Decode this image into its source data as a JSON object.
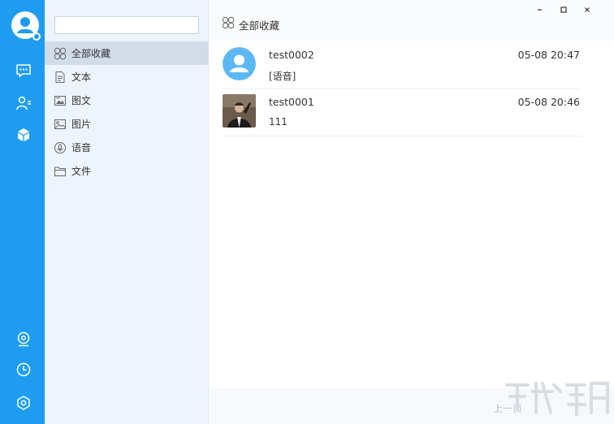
{
  "search": {
    "placeholder": "",
    "value": ""
  },
  "rail": {
    "avatar_icon": "user-avatar-icon",
    "items": [
      {
        "name": "chat",
        "icon": "chat-bubble-icon"
      },
      {
        "name": "contacts",
        "icon": "contacts-icon"
      },
      {
        "name": "favorites",
        "icon": "cube-icon",
        "active": true
      }
    ],
    "bottom_items": [
      {
        "name": "location",
        "icon": "location-icon"
      },
      {
        "name": "history",
        "icon": "clock-icon"
      },
      {
        "name": "settings",
        "icon": "gear-icon"
      }
    ]
  },
  "categories": [
    {
      "label": "全部收藏",
      "icon": "grid-icon",
      "active": true
    },
    {
      "label": "文本",
      "icon": "text-file-icon"
    },
    {
      "label": "图文",
      "icon": "image-text-icon"
    },
    {
      "label": "图片",
      "icon": "picture-icon"
    },
    {
      "label": "语音",
      "icon": "voice-icon"
    },
    {
      "label": "文件",
      "icon": "folder-icon"
    }
  ],
  "header": {
    "title": "全部收藏"
  },
  "window_controls": {
    "minimize": "-",
    "maximize": "□",
    "close": "×"
  },
  "items": [
    {
      "name": "test0002",
      "preview": "[语音]",
      "time": "05-08 20:47",
      "avatar": "default-avatar"
    },
    {
      "name": "test0001",
      "preview": "111",
      "time": "05-08 20:46",
      "avatar": "photo-avatar"
    }
  ],
  "pager": {
    "prev": "上一页"
  },
  "colors": {
    "accent": "#1e9df0",
    "panel_bg": "#eef4fb",
    "active_row": "#d2dce8"
  }
}
